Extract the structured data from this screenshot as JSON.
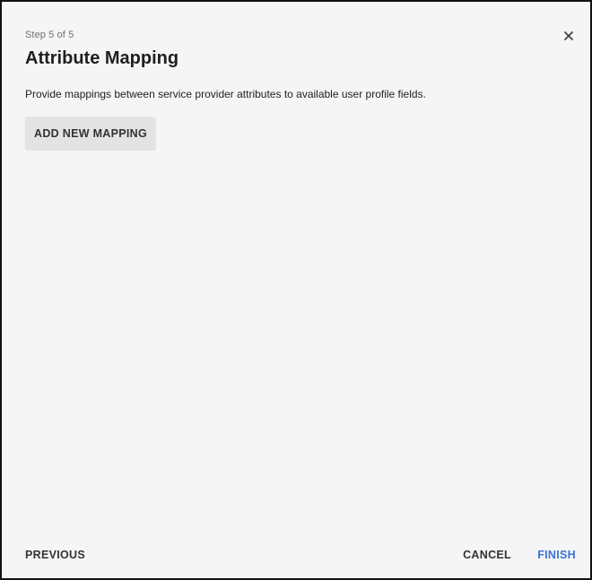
{
  "dialog": {
    "step_label": "Step 5 of 5",
    "title": "Attribute Mapping",
    "description": "Provide mappings between service provider attributes to available user profile fields.",
    "close_icon": "close-icon"
  },
  "actions": {
    "add_mapping_label": "ADD NEW MAPPING"
  },
  "footer": {
    "previous_label": "PREVIOUS",
    "cancel_label": "CANCEL",
    "finish_label": "FINISH"
  },
  "colors": {
    "background": "#f5f5f5",
    "primary_accent": "#3b73d6",
    "button_fill": "#e3e3e3"
  }
}
